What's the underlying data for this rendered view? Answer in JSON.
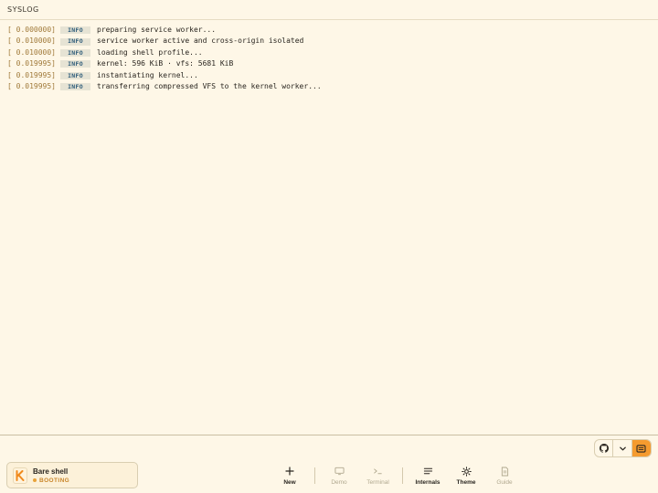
{
  "topbar": {
    "title": "SYSLOG"
  },
  "log": [
    {
      "ts": "[ 0.000000]",
      "level": "INFO",
      "msg": "preparing service worker..."
    },
    {
      "ts": "[ 0.010000]",
      "level": "INFO",
      "msg": "service worker active and cross-origin isolated"
    },
    {
      "ts": "[ 0.010000]",
      "level": "INFO",
      "msg": "loading shell profile..."
    },
    {
      "ts": "[ 0.019995]",
      "level": "INFO",
      "msg": "kernel: 596 KiB · vfs: 5681 KiB"
    },
    {
      "ts": "[ 0.019995]",
      "level": "INFO",
      "msg": "instantiating kernel..."
    },
    {
      "ts": "[ 0.019995]",
      "level": "INFO",
      "msg": "transferring compressed VFS to the kernel worker..."
    }
  ],
  "session": {
    "name": "Bare shell",
    "status": "BOOTING",
    "logo_letter": "K"
  },
  "dock": {
    "new": "New",
    "demo": "Demo",
    "terminal": "Terminal",
    "internals": "Internals",
    "theme": "Theme",
    "guide": "Guide"
  },
  "colors": {
    "accent": "#f59b2f",
    "timestamp": "#a07a3a",
    "badge_text": "#2f5d7a",
    "background": "#fef7e7"
  }
}
